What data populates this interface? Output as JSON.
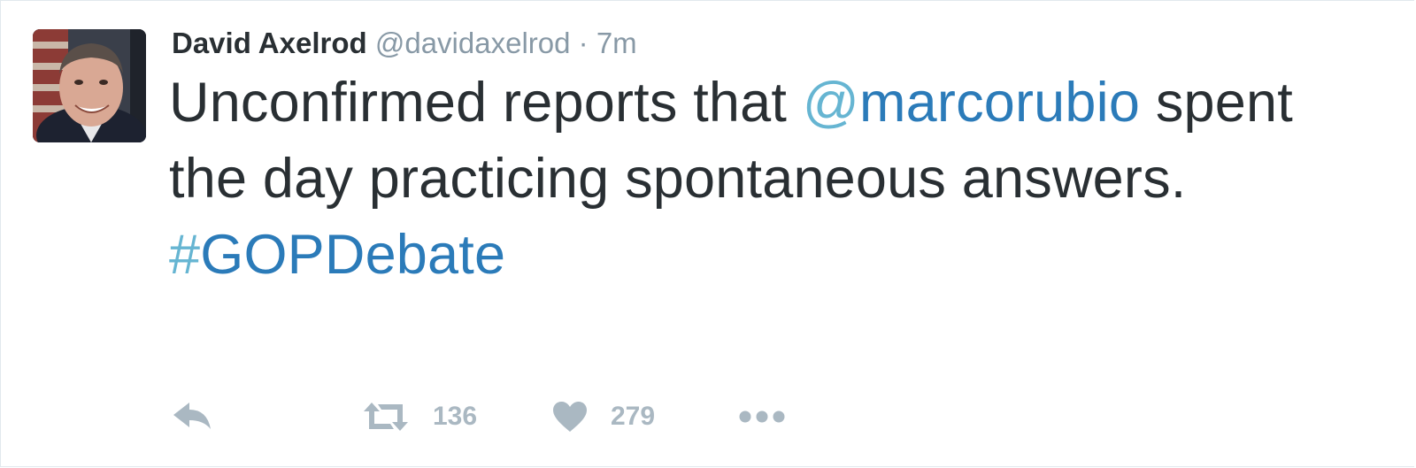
{
  "tweet": {
    "author": {
      "fullname": "David Axelrod",
      "username": "@davidaxelrod",
      "separator": "·",
      "timestamp": "7m"
    },
    "text": {
      "part1": "Unconfirmed reports that ",
      "mention_at": "@",
      "mention_name": "marcorubio",
      "part2": "spent the day practicing spontaneous answers.",
      "hashtag_hash": "#",
      "hashtag_name": "GOPDebate"
    },
    "actions": {
      "reply_icon": "reply-icon",
      "retweet_icon": "retweet-icon",
      "retweet_count": "136",
      "like_icon": "heart-icon",
      "like_count": "279",
      "more_icon": "more-dots-icon"
    },
    "colors": {
      "link": "#2b7bb9",
      "text": "#292f33",
      "muted": "#8899a6",
      "icon": "#aab8c2"
    }
  }
}
